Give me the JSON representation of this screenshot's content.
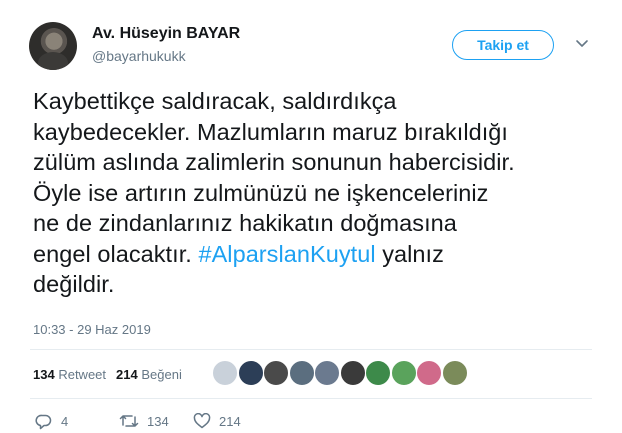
{
  "author": {
    "display_name": "Av. Hüseyin BAYAR",
    "handle": "@bayarhukukk"
  },
  "follow_button": {
    "label": "Takip et"
  },
  "menu_icon": "chevron-down-icon",
  "tweet": {
    "lines": [
      "Kaybettikçe saldıracak, saldırdıkça",
      "kaybedecekler. Mazlumların maruz bırakıldığı",
      "zülüm aslında zalimlerin sonunun habercisidir.",
      "Öyle ise artırın zulmünüzü ne işkenceleriniz",
      "ne de zindanlarınız hakikatın doğmasına"
    ],
    "line6_before": "engel olacaktır. ",
    "hashtag": "#AlparslanKuytul",
    "line6_after": " yalnız",
    "line7": "değildir."
  },
  "timestamp": "10:33 - 29 Haz 2019",
  "stats": {
    "retweets_count": "134",
    "retweets_label": "Retweet",
    "likes_count": "214",
    "likes_label": "Beğeni"
  },
  "likers_colors": [
    "#c9d1da",
    "#2c3e57",
    "#4a4a4a",
    "#5b6e7f",
    "#6b7a8f",
    "#3a3a3a",
    "#3d8a4a",
    "#5aa35c",
    "#d06a8a",
    "#7b8b5a"
  ],
  "actions": {
    "reply_count": "4",
    "retweet_count": "134",
    "like_count": "214"
  },
  "colors": {
    "accent": "#1da1f2",
    "muted": "#657786"
  }
}
